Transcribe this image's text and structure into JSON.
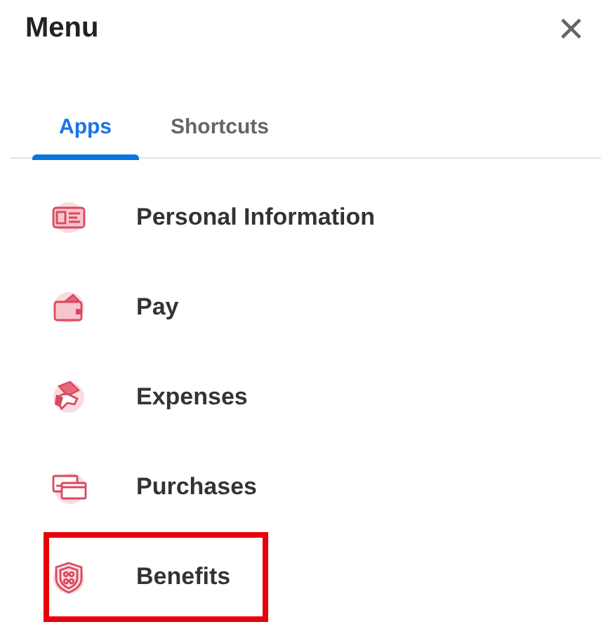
{
  "header": {
    "title": "Menu",
    "close": "×"
  },
  "tabs": [
    {
      "label": "Apps",
      "selected": true
    },
    {
      "label": "Shortcuts",
      "selected": false
    }
  ],
  "apps": [
    {
      "label": "Personal Information",
      "kind": "idcard",
      "highlighted": false
    },
    {
      "label": "Pay",
      "kind": "wallet",
      "highlighted": false
    },
    {
      "label": "Expenses",
      "kind": "cash",
      "highlighted": false
    },
    {
      "label": "Purchases",
      "kind": "cards",
      "highlighted": false
    },
    {
      "label": "Benefits",
      "kind": "shield",
      "highlighted": true
    }
  ]
}
